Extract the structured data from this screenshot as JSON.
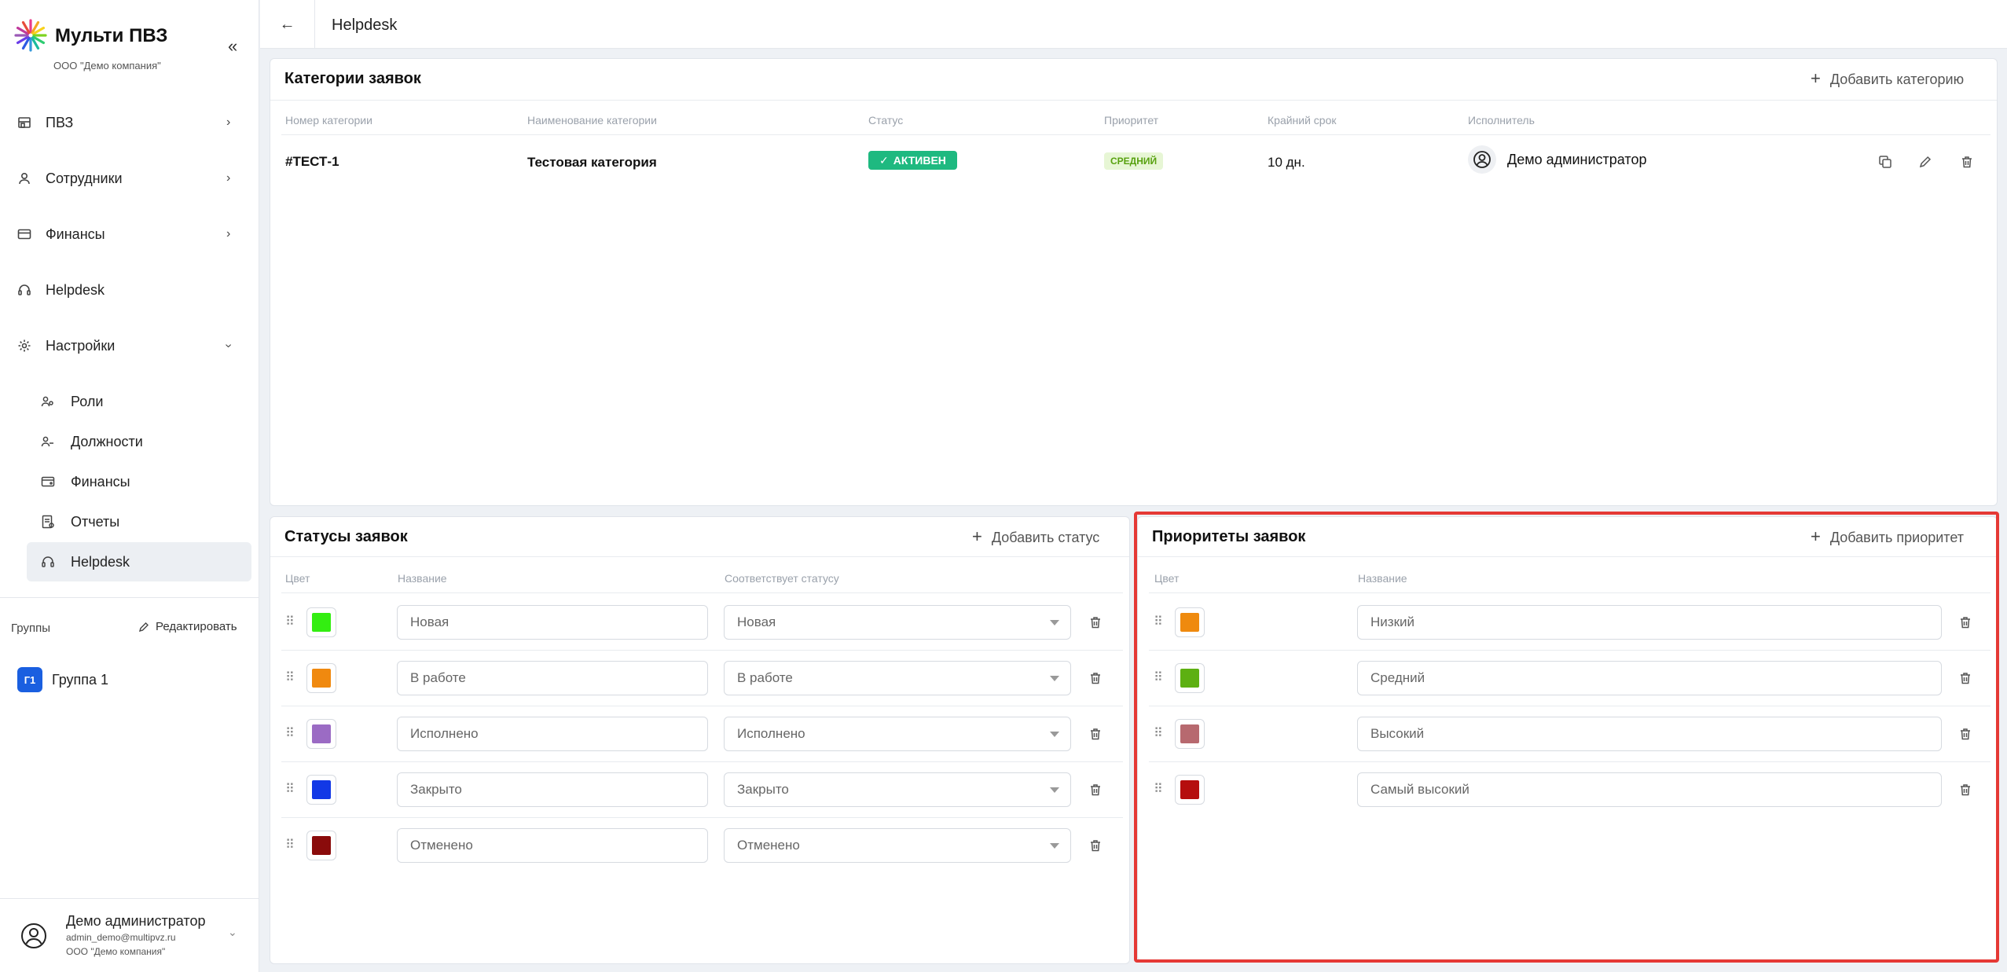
{
  "sidebar": {
    "brand_name": "Мульти ПВЗ",
    "company": "ООО \"Демо компания\"",
    "collapse_icon": "double-chevron-left-icon",
    "nav": [
      {
        "label": "ПВЗ",
        "icon": "store-icon"
      },
      {
        "label": "Сотрудники",
        "icon": "user-icon"
      },
      {
        "label": "Финансы",
        "icon": "card-icon"
      },
      {
        "label": "Helpdesk",
        "icon": "headset-icon"
      },
      {
        "label": "Настройки",
        "icon": "gear-icon"
      }
    ],
    "settings_sub": [
      {
        "label": "Роли",
        "icon": "users-icon"
      },
      {
        "label": "Должности",
        "icon": "users-icon"
      },
      {
        "label": "Финансы",
        "icon": "wallet-icon"
      },
      {
        "label": "Отчеты",
        "icon": "report-icon"
      },
      {
        "label": "Helpdesk",
        "icon": "headset-icon"
      }
    ],
    "groups_title": "Группы",
    "groups_edit": "Редактировать",
    "groups": [
      {
        "badge": "Г1",
        "label": "Группа 1"
      }
    ],
    "user": {
      "name": "Демо администратор",
      "email": "admin_demo@multipvz.ru",
      "company": "ООО \"Демо компания\""
    }
  },
  "topbar": {
    "title": "Helpdesk"
  },
  "categories": {
    "title": "Категории заявок",
    "add_label": "Добавить категорию",
    "columns": [
      "Номер категории",
      "Наименование категории",
      "Статус",
      "Приоритет",
      "Крайний срок",
      "Исполнитель"
    ],
    "rows": [
      {
        "number": "#ТЕСТ-1",
        "name": "Тестовая категория",
        "status": "АКТИВЕН",
        "priority": "СРЕДНИЙ",
        "deadline": "10 дн.",
        "assignee": "Демо администратор"
      }
    ]
  },
  "statuses": {
    "title": "Статусы заявок",
    "add_label": "Добавить статус",
    "columns": [
      "Цвет",
      "Название",
      "Соответствует статусу"
    ],
    "rows": [
      {
        "color": "#33ee11",
        "name": "Новая",
        "maps_to": "Новая"
      },
      {
        "color": "#f0890f",
        "name": "В работе",
        "maps_to": "В работе"
      },
      {
        "color": "#9b6bc4",
        "name": "Исполнено",
        "maps_to": "Исполнено"
      },
      {
        "color": "#1238e6",
        "name": "Закрыто",
        "maps_to": "Закрыто"
      },
      {
        "color": "#8a0b0b",
        "name": "Отменено",
        "maps_to": "Отменено"
      }
    ]
  },
  "priorities": {
    "title": "Приоритеты заявок",
    "add_label": "Добавить приоритет",
    "columns": [
      "Цвет",
      "Название"
    ],
    "rows": [
      {
        "color": "#ef8a0e",
        "name": "Низкий"
      },
      {
        "color": "#5db012",
        "name": "Средний"
      },
      {
        "color": "#b7696f",
        "name": "Высокий"
      },
      {
        "color": "#b50e0e",
        "name": "Самый высокий"
      }
    ]
  },
  "colors": {
    "accent": "#1a5fe0",
    "active_badge": "#1eb980",
    "highlight": "#e53935"
  }
}
